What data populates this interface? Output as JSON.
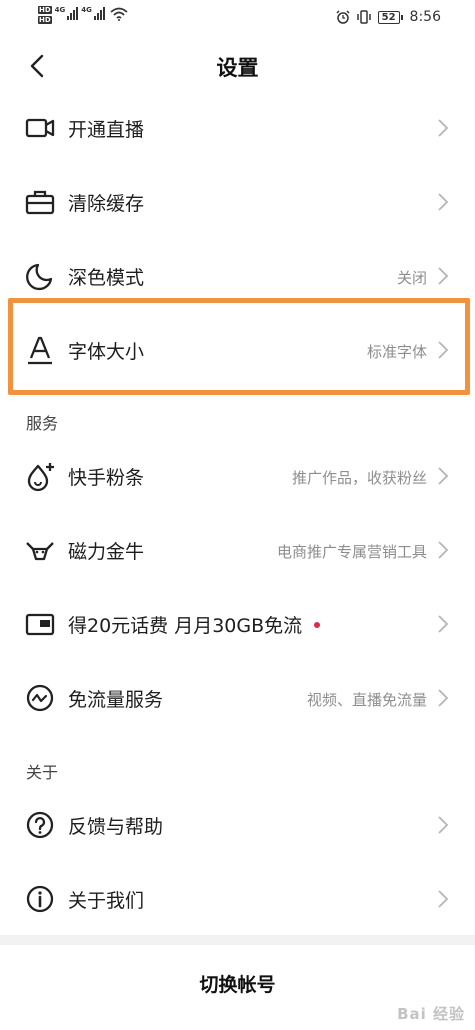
{
  "status_bar": {
    "hd1": "HD",
    "hd2": "HD",
    "net1": "4G",
    "net2": "4G",
    "battery": "52",
    "time": "8:56"
  },
  "header": {
    "title": "设置"
  },
  "account": {
    "live": {
      "label": "开通直播",
      "icon": "video-camera-icon"
    },
    "cache": {
      "label": "清除缓存",
      "icon": "toolbox-icon"
    },
    "dark": {
      "label": "深色模式",
      "value": "关闭",
      "icon": "moon-icon"
    },
    "font": {
      "label": "字体大小",
      "value": "标准字体",
      "icon": "font-a-icon"
    }
  },
  "services": {
    "heading": "服务",
    "fans": {
      "label": "快手粉条",
      "value": "推广作品，收获粉丝",
      "icon": "flame-plus-icon"
    },
    "bull": {
      "label": "磁力金牛",
      "value": "电商推广专属营销工具",
      "icon": "bull-icon"
    },
    "promo": {
      "label": "得20元话费 月月30GB免流",
      "icon": "wallet-icon"
    },
    "freeflow": {
      "label": "免流量服务",
      "value": "视频、直播免流量",
      "icon": "wave-circle-icon"
    }
  },
  "about": {
    "heading": "关于",
    "help": {
      "label": "反馈与帮助",
      "icon": "question-circle-icon"
    },
    "us": {
      "label": "关于我们",
      "icon": "info-circle-icon"
    }
  },
  "switch_account": "切换帐号",
  "watermark": "Bai 经验",
  "colors": {
    "highlight": "#f0923e",
    "dot": "#e0284a",
    "value": "#8e8e8e"
  }
}
